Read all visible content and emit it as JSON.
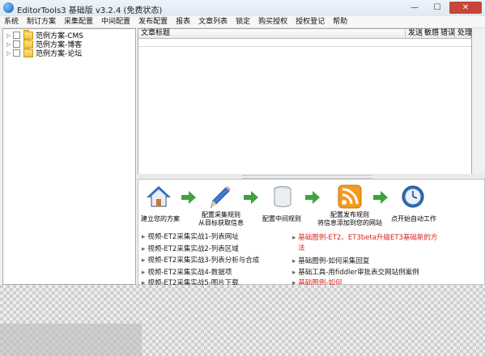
{
  "window": {
    "title": "EditorTools3 基础版 v3.2.4 (免费状态)",
    "controls": {
      "minimize": "—",
      "maximize": "☐",
      "close": "✕"
    }
  },
  "menu": [
    "系统",
    "制订方案",
    "采集配置",
    "中间配置",
    "发布配置",
    "报表",
    "文章列表",
    "锁定",
    "购买授权",
    "授权登记",
    "帮助"
  ],
  "tree": {
    "items": [
      "范例方案-CMS",
      "范例方案-博客",
      "范例方案-论坛"
    ]
  },
  "grid": {
    "columns": [
      "文章标题",
      "发送",
      "敏感",
      "错误",
      "处理"
    ]
  },
  "steps": {
    "s1": "建立您的方案",
    "s2a": "配置采集规则",
    "s2b": "从目标获取信息",
    "s3": "配置中间规则",
    "s4a": "配置发布规则",
    "s4b": "将信息添加到您的网站",
    "s5": "点开始自动工作"
  },
  "links_left": [
    "视频-ET2采集实战1-列表网址",
    "视频-ET2采集实战2-列表区域",
    "视频-ET2采集实战3-列表分析与合成",
    "视频-ET2采集实战4-数据项",
    "视频-ET2采集实战5-图片下载"
  ],
  "links_right": [
    {
      "text": "基础图例-ET2、ET3beta升级ET3基础新的方",
      "red": true
    },
    {
      "text": "法",
      "red": true
    },
    {
      "text": "基础图例-如何采集回复",
      "red": false
    },
    {
      "text": "基础工具-用fiddler审批表交网站例案例",
      "red": false
    },
    {
      "text": "基础图例-如何",
      "red": true
    }
  ],
  "colors": {
    "accent_red": "#d8221c",
    "close_button": "#c7463a"
  },
  "icons": {
    "step1": "home-icon",
    "step2": "pencil-icon",
    "step3": "database-icon",
    "step4": "rss-icon",
    "step5": "clock-icon"
  }
}
